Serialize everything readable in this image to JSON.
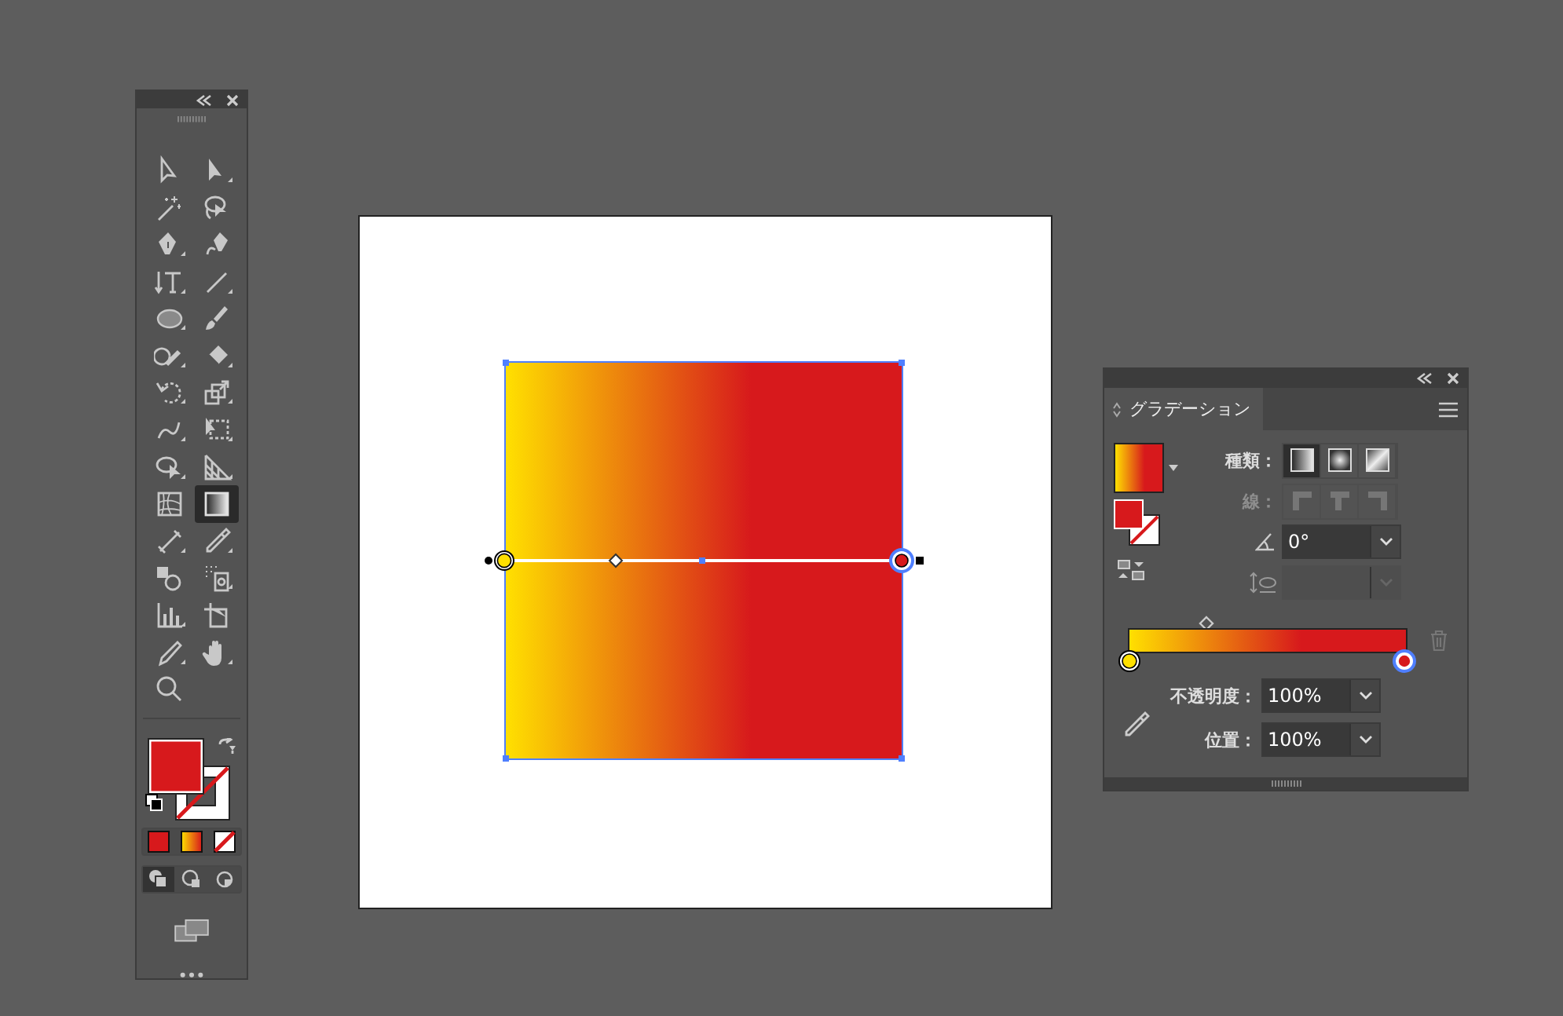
{
  "toolbar": {
    "tools": [
      {
        "selected": false
      },
      {
        "selected": false
      },
      {
        "selected": false
      },
      {
        "selected": false
      },
      {
        "selected": false
      },
      {
        "selected": false
      },
      {
        "selected": false
      },
      {
        "selected": false
      },
      {
        "selected": false
      },
      {
        "selected": false
      },
      {
        "selected": false
      },
      {
        "selected": false
      },
      {
        "selected": false
      },
      {
        "selected": false
      },
      {
        "selected": false
      },
      {
        "selected": false
      },
      {
        "selected": false
      },
      {
        "selected": false
      },
      {
        "selected": false
      },
      {
        "selected": true
      },
      {
        "selected": false
      },
      {
        "selected": false
      },
      {
        "selected": false
      },
      {
        "selected": false
      },
      {
        "selected": false
      },
      {
        "selected": false
      },
      {
        "selected": false
      },
      {
        "selected": false
      },
      {
        "selected": false
      }
    ],
    "draw_modes": [
      {
        "selected": true
      },
      {
        "selected": false
      },
      {
        "selected": false
      }
    ]
  },
  "canvas": {
    "gradient_stops": [
      {
        "color": "#ffe000",
        "selected": false
      },
      {
        "color": "#d7191c",
        "selected": true
      }
    ]
  },
  "gradient_panel": {
    "tab": {
      "label": "グラデーション",
      "selected": true
    },
    "type_label": "種類：",
    "types": [
      {
        "selected": true
      },
      {
        "selected": false
      },
      {
        "selected": false
      }
    ],
    "stroke_label": "線：",
    "stroke_disabled": true,
    "angle": "0°",
    "opacity_label": "不透明度：",
    "opacity": "100%",
    "location_label": "位置：",
    "location": "100%"
  }
}
